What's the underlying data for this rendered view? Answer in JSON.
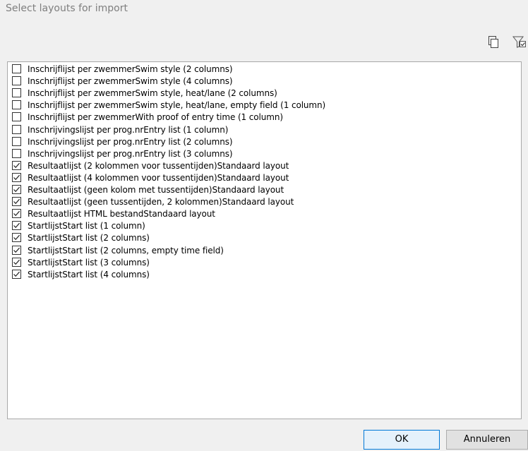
{
  "dialog": {
    "title": "Select layouts for import"
  },
  "toolbar": {
    "icons": [
      "copy-icon",
      "filter-check-icon"
    ]
  },
  "layouts": [
    {
      "label": "Inschrijflijst per zwemmerSwim style (2 columns)",
      "checked": false
    },
    {
      "label": "Inschrijflijst per zwemmerSwim style (4 columns)",
      "checked": false
    },
    {
      "label": "Inschrijflijst per zwemmerSwim style, heat/lane (2 columns)",
      "checked": false
    },
    {
      "label": "Inschrijflijst per zwemmerSwim style, heat/lane, empty field (1 column)",
      "checked": false
    },
    {
      "label": "Inschrijflijst per zwemmerWith proof of entry time (1 column)",
      "checked": false
    },
    {
      "label": "Inschrijvingslijst per prog.nrEntry list (1 column)",
      "checked": false
    },
    {
      "label": "Inschrijvingslijst per prog.nrEntry list (2 columns)",
      "checked": false
    },
    {
      "label": "Inschrijvingslijst per prog.nrEntry list (3 columns)",
      "checked": false
    },
    {
      "label": "Resultaatlijst (2 kolommen voor tussentijden)Standaard layout",
      "checked": true
    },
    {
      "label": "Resultaatlijst (4 kolommen voor tussentijden)Standaard layout",
      "checked": true
    },
    {
      "label": "Resultaatlijst (geen kolom met tussentijden)Standaard layout",
      "checked": true
    },
    {
      "label": "Resultaatlijst (geen tussentijden, 2 kolommen)Standaard layout",
      "checked": true
    },
    {
      "label": "Resultaatlijst HTML bestandStandaard layout",
      "checked": true
    },
    {
      "label": "StartlijstStart list (1 column)",
      "checked": true
    },
    {
      "label": "StartlijstStart list (2 columns)",
      "checked": true
    },
    {
      "label": "StartlijstStart list (2 columns, empty time field)",
      "checked": true
    },
    {
      "label": "StartlijstStart list (3 columns)",
      "checked": true
    },
    {
      "label": "StartlijstStart list (4 columns)",
      "checked": true
    }
  ],
  "buttons": {
    "ok_label": "OK",
    "cancel_label": "Annuleren"
  }
}
